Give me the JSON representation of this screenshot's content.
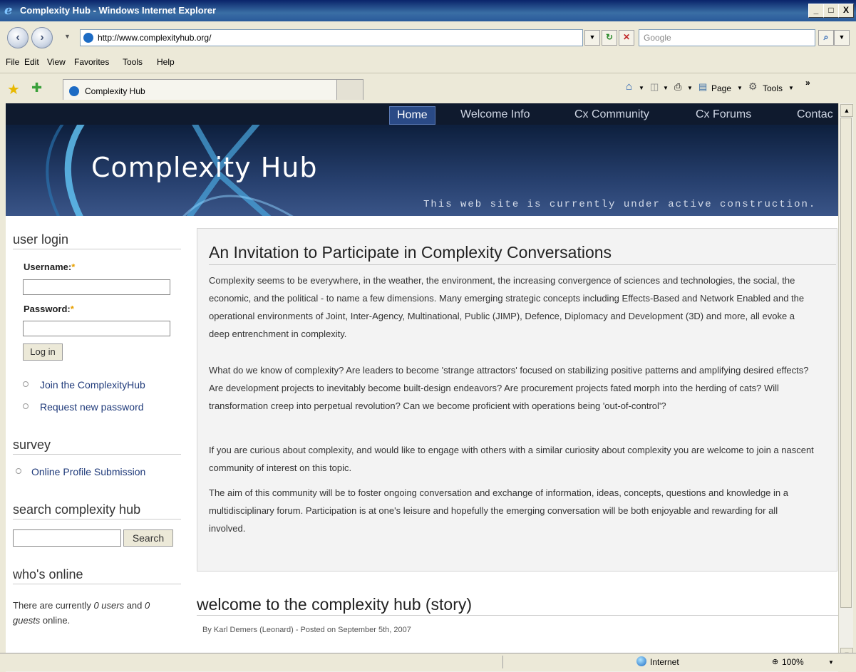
{
  "window": {
    "title": "Complexity Hub - Windows Internet Explorer",
    "controls": {
      "minimize": "_",
      "maximize": "□",
      "close": "X"
    }
  },
  "address": {
    "url": "http://www.complexityhub.org/",
    "search_placeholder": "Google"
  },
  "menu": [
    "File",
    "Edit",
    "View",
    "Favorites",
    "Tools",
    "Help"
  ],
  "tab": {
    "label": "Complexity Hub"
  },
  "commandbar": {
    "page": "Page",
    "tools": "Tools"
  },
  "site": {
    "nav": [
      "Home",
      "Welcome Info",
      "Cx Community",
      "Cx Forums",
      "Contac"
    ],
    "title": "Complexity Hub",
    "tagline": "This web site is currently under active construction."
  },
  "sidebar": {
    "user_login": {
      "heading": "user login",
      "username_label": "Username:",
      "password_label": "Password:",
      "required_mark": "*",
      "login_button": "Log in",
      "links": [
        "Join the ComplexityHub",
        "Request new password"
      ]
    },
    "survey": {
      "heading": "survey",
      "links": [
        "Online Profile Submission"
      ]
    },
    "search": {
      "heading": "search complexity hub",
      "button": "Search"
    },
    "whos_online": {
      "heading": "who's online",
      "text_before": "There are currently ",
      "users": "0 users",
      "text_mid": " and ",
      "guests_num": "0",
      "guests_word": "guests",
      "text_after": " online."
    }
  },
  "main": {
    "heading": "An Invitation to Participate in Complexity Conversations",
    "paragraphs": [
      "Complexity seems to be everywhere, in the weather, the environment, the increasing convergence of sciences and technologies, the social, the economic, and the political - to name a few dimensions. Many emerging strategic concepts including Effects-Based and Network Enabled and the operational environments of Joint, Inter-Agency, Multinational, Public (JIMP), Defence, Diplomacy and Development (3D) and more, all evoke a deep entrenchment in complexity.",
      "What do we know of complexity? Are leaders to become 'strange attractors' focused on stabilizing positive patterns and amplifying desired effects? Are development projects to inevitably become built-design endeavors? Are procurement projects fated morph into the herding of cats? Will transformation creep into perpetual revolution? Can we become proficient with operations being 'out-of-control'?",
      "If you are curious about complexity, and would like to engage with others with a similar curiosity about complexity you are welcome to join a nascent community of interest on this topic.",
      "The aim of this community will be to foster ongoing conversation and exchange of information, ideas, concepts, questions and knowledge in a multidisciplinary forum. Participation is at one's leisure and hopefully the emerging conversation will be both enjoyable and rewarding for all involved."
    ],
    "story_title": "welcome to the complexity hub (story)",
    "story_meta": "By Karl Demers (Leonard) - Posted on September 5th, 2007"
  },
  "status": {
    "zone": "Internet",
    "zoom": "100%"
  }
}
